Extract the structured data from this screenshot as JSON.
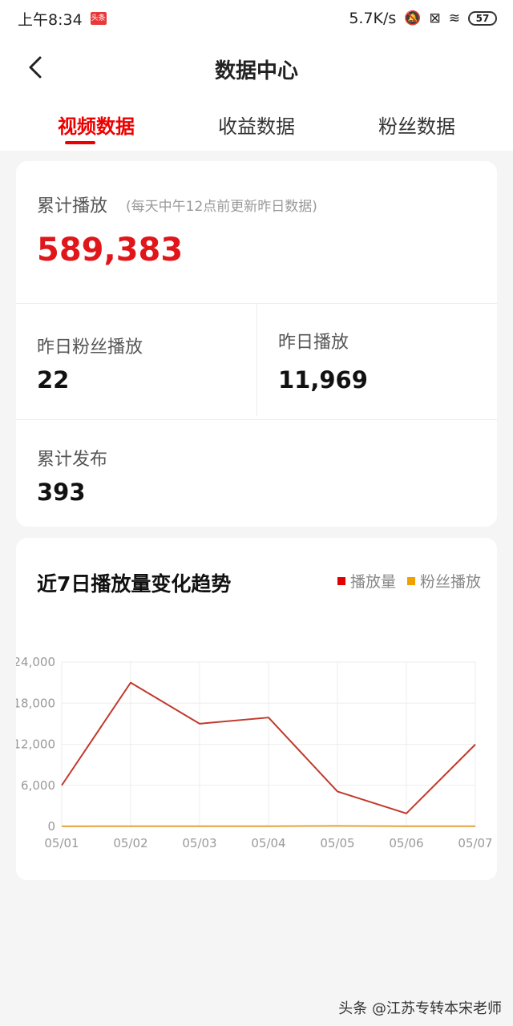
{
  "status_bar": {
    "time": "上午8:34",
    "app_badge": "头条",
    "network_speed": "5.7K/s",
    "battery": "57",
    "icons": [
      "bell-muted-icon",
      "sim-off-icon",
      "wifi-icon",
      "battery-icon"
    ]
  },
  "header": {
    "title": "数据中心",
    "back_icon": "chevron-left-icon",
    "tabs": [
      {
        "label": "视频数据",
        "active": true
      },
      {
        "label": "收益数据",
        "active": false
      },
      {
        "label": "粉丝数据",
        "active": false
      }
    ]
  },
  "summary": {
    "total_label": "累计播放",
    "total_note": "(每天中午12点前更新昨日数据)",
    "total_value": "589,383",
    "fan_plays_label": "昨日粉丝播放",
    "fan_plays_value": "22",
    "yesterday_plays_label": "昨日播放",
    "yesterday_plays_value": "11,969",
    "published_label": "累计发布",
    "published_value": "393"
  },
  "trend": {
    "title": "近7日播放量变化趋势"
  },
  "chart_data": {
    "type": "line",
    "x": [
      "05/01",
      "05/02",
      "05/03",
      "05/04",
      "05/05",
      "05/06",
      "05/07"
    ],
    "series": [
      {
        "name": "播放量",
        "color": "#c0392b",
        "legend_color": "#e00000",
        "values": [
          6000,
          21000,
          15000,
          15900,
          5100,
          1900,
          11969
        ]
      },
      {
        "name": "粉丝播放",
        "color": "#e6a23c",
        "legend_color": "#f0a000",
        "values": [
          20,
          25,
          22,
          24,
          80,
          30,
          22
        ]
      }
    ],
    "yticks": [
      "0",
      "6,000",
      "12,000",
      "18,000",
      "24,000"
    ],
    "ylim": [
      0,
      24000
    ],
    "grid": true,
    "legend": "top-right"
  },
  "watermark": "头条 @江苏专转本宋老师"
}
